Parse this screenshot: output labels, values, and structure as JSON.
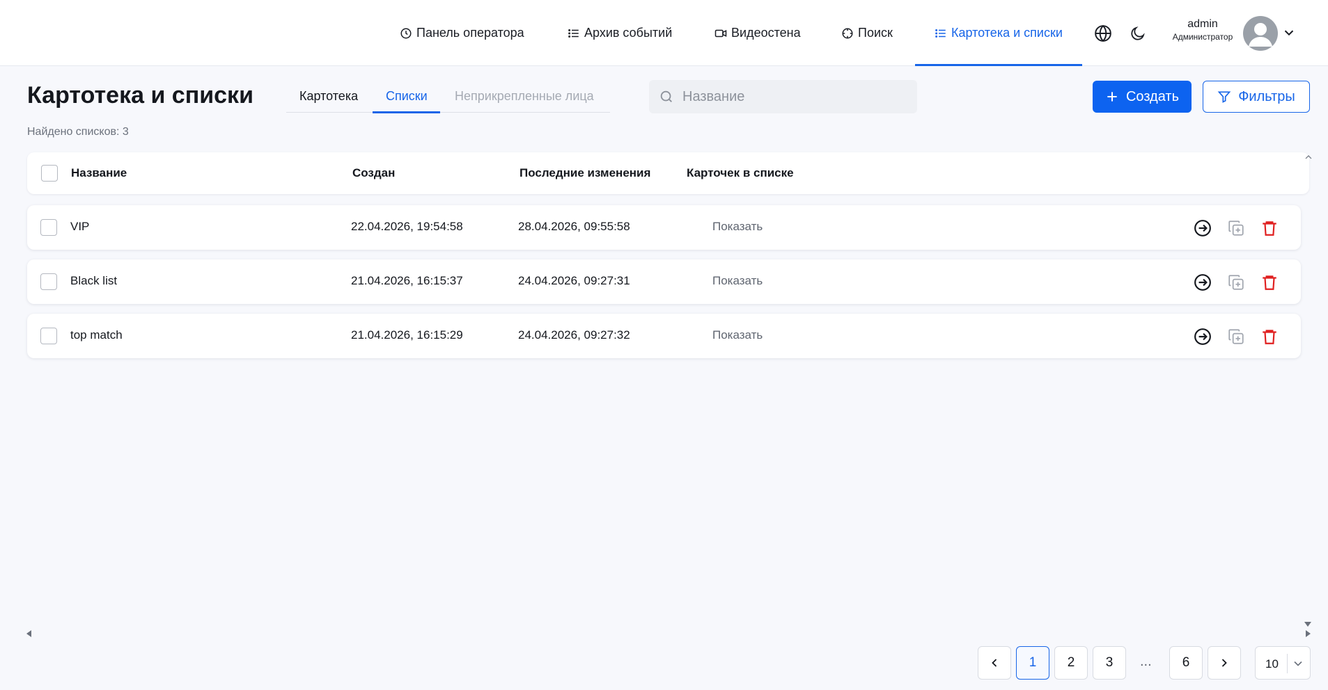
{
  "nav": {
    "items": [
      {
        "label": "Панель оператора",
        "icon": "clock-icon"
      },
      {
        "label": "Архив событий",
        "icon": "list-icon"
      },
      {
        "label": "Видеостена",
        "icon": "video-icon"
      },
      {
        "label": "Поиск",
        "icon": "crosshair-icon"
      },
      {
        "label": "Картотека и списки",
        "icon": "list-icon",
        "active": true
      }
    ],
    "user": {
      "name": "admin",
      "role": "Администратор"
    }
  },
  "page": {
    "title": "Картотека и списки",
    "found_text": "Найдено списков: 3",
    "tabs": [
      {
        "label": "Картотека"
      },
      {
        "label": "Списки",
        "active": true
      },
      {
        "label": "Неприкрепленные лица",
        "disabled": true
      }
    ],
    "search": {
      "placeholder": "Название",
      "value": ""
    },
    "create_label": "Создать",
    "filters_label": "Фильтры"
  },
  "table": {
    "columns": [
      "Название",
      "Создан",
      "Последние изменения",
      "Карточек в списке"
    ],
    "rows": [
      {
        "name": "VIP",
        "created": "22.04.2026, 19:54:58",
        "modified": "28.04.2026, 09:55:58",
        "cards": "Показать"
      },
      {
        "name": "Black list",
        "created": "21.04.2026, 16:15:37",
        "modified": "24.04.2026, 09:27:31",
        "cards": "Показать"
      },
      {
        "name": "top match",
        "created": "21.04.2026, 16:15:29",
        "modified": "24.04.2026, 09:27:32",
        "cards": "Показать"
      }
    ]
  },
  "pagination": {
    "pages": [
      "1",
      "2",
      "3",
      "6"
    ],
    "current": "1",
    "ellipsis": "...",
    "per_page": "10"
  },
  "colors": {
    "accent": "#1765e8",
    "danger": "#e02020",
    "background": "#f7f8fc"
  }
}
